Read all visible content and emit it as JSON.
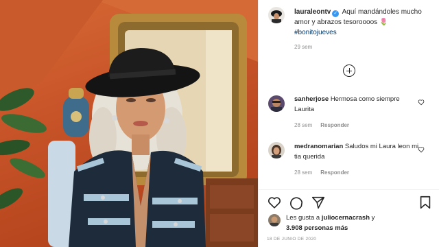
{
  "post": {
    "author": "lauraleontv",
    "caption": "Aquí mandándoles mucho amor y abrazos tesoroooos 🌷",
    "hashtag": "#bonitojueves",
    "time_ago": "29 sem",
    "date": "18 DE JUNIO DE 2020"
  },
  "comments": [
    {
      "user": "sanherjose",
      "text": "Hermosa como siempre Laurita",
      "time_ago": "28 sem",
      "reply_label": "Responder"
    },
    {
      "user": "medranomarian",
      "text": "Saludos mi Laura leon mi tia querida",
      "time_ago": "28 sem",
      "reply_label": "Responder"
    }
  ],
  "likes": {
    "prefix": "Les gusta a",
    "first_user": "juliocernacrash",
    "joiner": "y",
    "others": "3.908 personas más"
  },
  "icons": {
    "verified": "verified-badge-icon",
    "load_more": "plus-circle-icon",
    "like": "heart-icon",
    "comment": "comment-bubble-icon",
    "share": "paper-plane-icon",
    "save": "bookmark-icon"
  },
  "colors": {
    "accent": "#3897f0",
    "hashtag": "#00376b",
    "muted": "#8e8e8e",
    "background": "#d76a34"
  }
}
